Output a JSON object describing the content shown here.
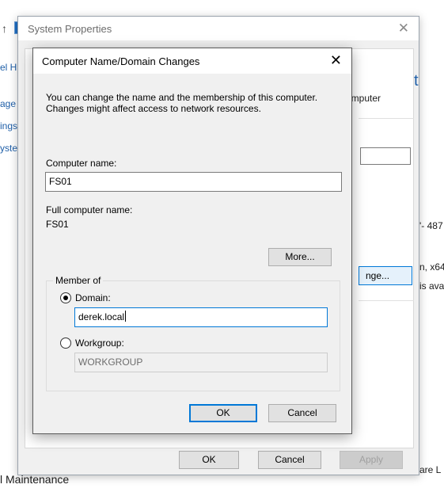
{
  "background": {
    "left_fragments": [
      "el H",
      "age",
      "ings",
      "yste"
    ],
    "right_fragments": {
      "heading": "ter",
      "computer_desc": "omputer",
      "windows_id": "'- 487",
      "system_type": "n, x64",
      "pen_touch": "is ava",
      "software": "are L"
    },
    "bottom_text": "l Maintenance"
  },
  "system_properties": {
    "title": "System Properties",
    "close_glyph": "✕",
    "change_button_label": "nge...",
    "ok_label": "OK",
    "cancel_label": "Cancel",
    "apply_label": "Apply"
  },
  "dialog": {
    "title": "Computer Name/Domain Changes",
    "close_glyph": "✕",
    "description": "You can change the name and the membership of this computer. Changes might affect access to network resources.",
    "computer_name_label": "Computer name:",
    "computer_name_value": "FS01",
    "full_name_label": "Full computer name:",
    "full_name_value": "FS01",
    "more_button_label": "More...",
    "member_of_label": "Member of",
    "domain_label": "Domain:",
    "domain_value": "derek.local",
    "workgroup_label": "Workgroup:",
    "workgroup_value": "WORKGROUP",
    "ok_label": "OK",
    "cancel_label": "Cancel",
    "selected_membership": "domain"
  },
  "colors": {
    "accent": "#0078d7",
    "link": "#1f5fa8"
  }
}
